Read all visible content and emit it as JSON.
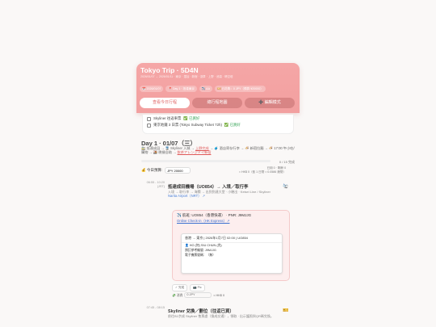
{
  "card": {
    "title": "Tokyo Trip · 5D4N",
    "subtitle": "2026/01/07 → 2026/01/11 · 東京 · 澀谷 · 新宿 · 淺草 · 上野 · 池袋 · 晴空塔",
    "pills": [
      "📅 2026/01/07",
      "📍 Day 1 · 抵達東京",
      "✈️ AA",
      "💴 已花費：0 JPY（預算 ¥20000）"
    ],
    "buttons": {
      "today": "查看今日行程",
      "map": "總行程地圖",
      "edit": "➕ 編輯模式"
    }
  },
  "checklist": [
    {
      "text": "Skyliner 往返車票",
      "status": "✅ 已買好"
    },
    {
      "text": "東京地鐵 3 日票 (Tokyo Subway Ticket 72h)",
      "status": "✅ 已買好"
    }
  ],
  "day": {
    "title": "Day 1 · 01/07（三）",
    "desc_1": "🚉 抵達成田 → 🚆 Skyliner 入城 → ",
    "desc_hl1": "上野完成",
    "desc_2": " → 🧳 酒店寄存行李 → 🍜 新宿拉麵 → 🍜 17:00 午小吃/購物 → 🍱 晚餐自助 → ",
    "desc_hl2": "飲茶アレンジドイ新宿",
    "progress_label": "0 / 15 完成"
  },
  "budget": {
    "label": "💰 今日預算:",
    "value": "JPY 20000",
    "right_1": "已用 0 · 剩餘 0",
    "right_2": "≈ HK$ 0（依 1 日幣 ≈ 0.0586 港幣）"
  },
  "item1": {
    "time": "06:55 - 10:20 (JST)",
    "title": "抵達成田機場（UO854）→ 入境／取行李",
    "sub": "入境 → 取行李 → 海關 → 出到到達大堂 · 小驗出 · Keisei Line / Skyliner",
    "link": "Narita Airport（NRT） ↗",
    "flight_head": "✈️ 航班: UO854（香港快運） · PNR: J9MJJG",
    "flight_link": "Online Check-in（HK Express）↗",
    "route": "香港 → 東京 | 2026年1月7日 02:00 | UO854",
    "passenger": "HO (何) SIU CHUN (兆)",
    "pnr_line": "預訂參考編號: J9MJJG",
    "ticket_line": "電子機票號碼：（無）",
    "btn_record": "✓ 完成",
    "btn_photo": "📷 Pic",
    "fee_label": "💸 消費",
    "fee_value": "0 JPY",
    "fee_hkd": "≈ HK$ 0"
  },
  "item2": {
    "time": "07:45 - 08:15",
    "title": "Skyliner 兌換／劃位（往返已買）",
    "sub": "前往B1京成 Skyliner 售票處（換成交通），領取 · 出示護照與QR碼兌換。"
  }
}
